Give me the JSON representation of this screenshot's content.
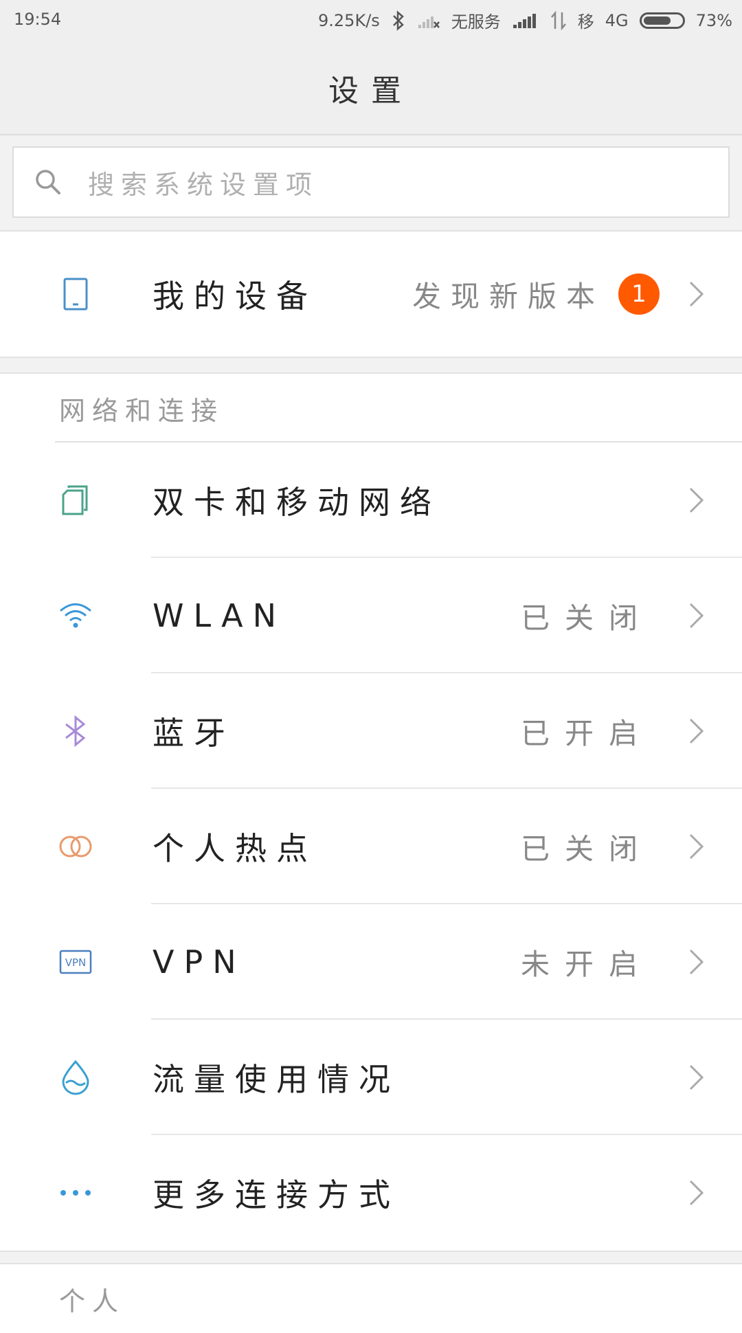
{
  "status_bar": {
    "time": "19:54",
    "network_speed": "9.25K/s",
    "sim1_status": "无服务",
    "sim2_label": "移",
    "network_type": "4G",
    "battery_percent": "73%",
    "battery_level": 0.73
  },
  "header": {
    "title": "设置"
  },
  "search": {
    "placeholder": "搜索系统设置项"
  },
  "my_device": {
    "label": "我的设备",
    "value": "发现新版本",
    "badge": "1"
  },
  "network_section": {
    "title": "网络和连接",
    "items": [
      {
        "label": "双卡和移动网络",
        "value": "",
        "icon": "sim-cards-icon"
      },
      {
        "label": "WLAN",
        "value": "已关闭",
        "icon": "wifi-icon"
      },
      {
        "label": "蓝牙",
        "value": "已开启",
        "icon": "bluetooth-icon"
      },
      {
        "label": "个人热点",
        "value": "已关闭",
        "icon": "hotspot-icon"
      },
      {
        "label": "VPN",
        "value": "未开启",
        "icon": "vpn-icon"
      },
      {
        "label": "流量使用情况",
        "value": "",
        "icon": "data-usage-icon"
      },
      {
        "label": "更多连接方式",
        "value": "",
        "icon": "more-icon"
      }
    ]
  },
  "personal_section": {
    "title": "个人"
  },
  "colors": {
    "badge": "#ff5a00",
    "device_icon": "#4a90c8",
    "sim_icon": "#4aa38a",
    "wifi_icon": "#3a97d8",
    "bluetooth_icon": "#a98ad8",
    "hotspot_icon": "#e89a6c",
    "vpn_icon": "#4a7fc0",
    "data_icon": "#3aa0d0",
    "more_icon": "#3a97d8"
  }
}
